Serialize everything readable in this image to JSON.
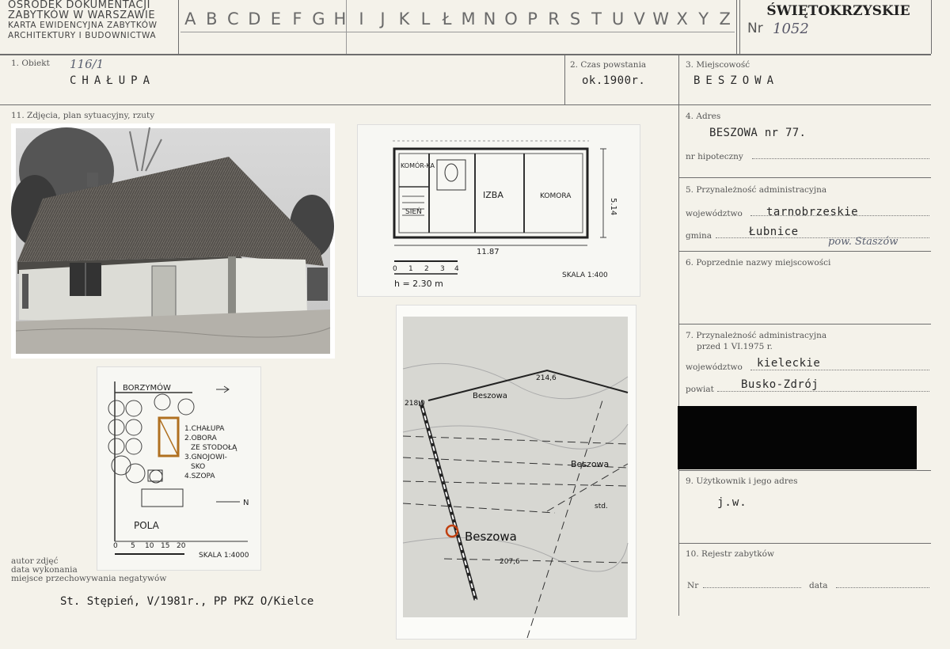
{
  "header": {
    "org_lines": [
      "OŚRODEK DOKUMENTACJI",
      "ZABYTKÓW W WARSZAWIE",
      "KARTA EWIDENCYJNA ZABYTKÓW",
      "ARCHITEKTURY I BUDOWNICTWA"
    ],
    "letters": [
      "A",
      "B",
      "C",
      "D",
      "E",
      "F",
      "G",
      "H",
      "I",
      "J",
      "K",
      "L",
      "Ł",
      "M",
      "N",
      "O",
      "P",
      "R",
      "S",
      "T",
      "U",
      "V",
      "W",
      "X",
      "Y",
      "Z"
    ],
    "region": "ŚWIĘTOKRZYSKIE",
    "nr_label": "Nr",
    "nr_value": "1052"
  },
  "fields": {
    "f1_label": "1. Obiekt",
    "f1_code": "116/1",
    "f1_value": "CHAŁUPA",
    "f2_label": "2. Czas powstania",
    "f2_value": "ok.1900r.",
    "f3_label": "3. Miejscowość",
    "f3_value": "BESZOWA",
    "f11_label": "11. Zdjęcia, plan sytuacyjny, rzuty",
    "f4_label": "4. Adres",
    "f4_value": "BESZOWA nr 77.",
    "f4_hipo_label": "nr hipoteczny",
    "f5_label": "5. Przynależność administracyjna",
    "f5_woj_label": "województwo",
    "f5_woj_value": "tarnobrzeskie",
    "f5_gmina_label": "gmina",
    "f5_gmina_value": "Łubnice",
    "f5_pow_note": "pow. Staszów",
    "f6_label": "6. Poprzednie nazwy miejscowości",
    "f7_label_1": "7. Przynależność administracyjna",
    "f7_label_2": "przed 1 VI.1975 r.",
    "f7_woj_label": "województwo",
    "f7_woj_value": "kieleckie",
    "f7_pow_label": "powiat",
    "f7_pow_value": "Busko-Zdrój",
    "f9_label": "9. Użytkownik i jego adres",
    "f9_value": "j.w.",
    "f10_label": "10. Rejestr zabytków",
    "f10_nr_label": "Nr",
    "f10_data_label": "data"
  },
  "floorplan": {
    "rooms": [
      "KOMÓR-KA",
      "IZBA",
      "KOMORA",
      "SIEŃ"
    ],
    "width_dim": "11.87",
    "depth_dim": "5.14",
    "height_note": "h = 2.30 m",
    "scale": "SKALA 1:400",
    "scale_ticks": [
      "0",
      "1",
      "2",
      "3",
      "4"
    ]
  },
  "siteplan": {
    "road": "BORZYMÓW",
    "legend": [
      "1.CHAŁUPA",
      "2.OBORA",
      "ZE STODOŁĄ",
      "3.GNOJOWI-",
      "SKO",
      "4.SZOPA"
    ],
    "fields_label": "POLA",
    "north": "N",
    "scale": "SKALA 1:4000",
    "scale_ticks": [
      "0",
      "5",
      "10",
      "15",
      "20"
    ]
  },
  "map": {
    "labels": [
      "Beszowa",
      "Beszowa",
      "Beszowa",
      "214,6",
      "218,0",
      "207,6",
      "std."
    ]
  },
  "credits": {
    "author_label": "autor zdjęć",
    "date_label": "data wykonania",
    "place_label": "miejsce przechowywania negatywów",
    "author_value": "St. Stępień, V/1981r., PP PKZ O/Kielce"
  }
}
